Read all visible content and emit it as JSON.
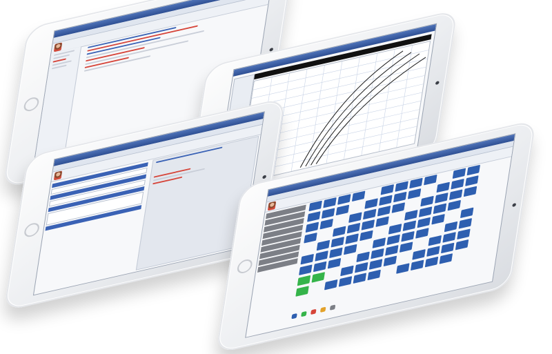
{
  "tablets": [
    {
      "id": "clinical-notes",
      "window_title": "",
      "toolbar_items": [
        "",
        "",
        "",
        "",
        ""
      ]
    },
    {
      "id": "growth-chart",
      "window_title": "",
      "toolbar_items": [
        "",
        "",
        "",
        ""
      ]
    },
    {
      "id": "patient-record",
      "window_title": "",
      "toolbar_items": [
        "",
        "",
        "",
        ""
      ]
    },
    {
      "id": "scheduler",
      "window_title": "",
      "toolbar_items": [
        "",
        "",
        "",
        "",
        ""
      ]
    }
  ],
  "icons": [
    "avatar-photo",
    "home-button",
    "front-camera"
  ],
  "colors": {
    "titlebar": "#2e4f93",
    "accent_blue": "#2e5fb0",
    "accent_red": "#d6453a",
    "accent_green": "#35b44a",
    "grey_block": "#7c7f86"
  }
}
